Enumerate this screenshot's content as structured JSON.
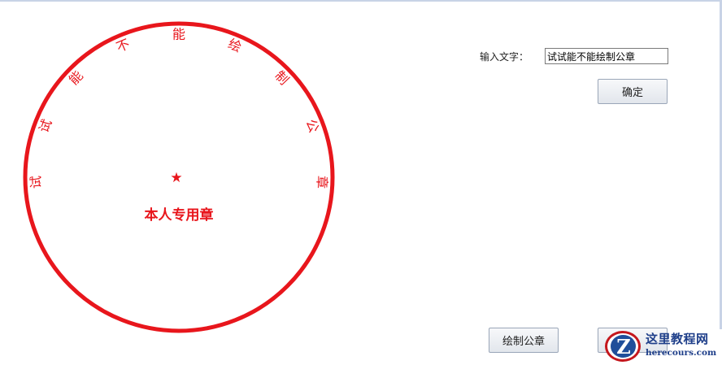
{
  "seal": {
    "ring_chars": [
      "试",
      "试",
      "能",
      "不",
      "能",
      "绘",
      "制",
      "公",
      "章"
    ],
    "star_glyph": "★",
    "center_text": "本人专用章",
    "color": "#e8161c"
  },
  "form": {
    "input_label": "输入文字：",
    "input_value": "试试能不能绘制公章",
    "confirm_label": "确定",
    "draw_label": "绘制公章",
    "partial_button_label": ""
  },
  "watermark": {
    "logo_letter": "Z",
    "cn_text": "这里教程网",
    "en_text": "herecours.com",
    "colors": {
      "red": "#c4171d",
      "blue": "#1f4e9a"
    }
  }
}
